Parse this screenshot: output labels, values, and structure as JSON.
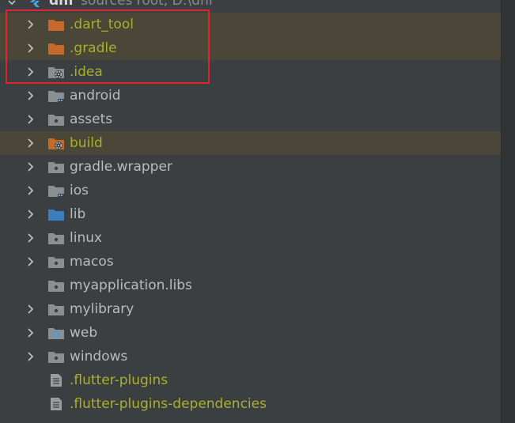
{
  "root": {
    "name": "dnf",
    "suffix": "sources root, D:\\dnf"
  },
  "colors": {
    "bg": "#3c3f41",
    "text": "#bbbbbb",
    "excluded": "#a8b02c",
    "excluded_row": "#4a4638",
    "folder": "#8c8f92",
    "excluded_folder": "#c7692b",
    "source_folder": "#3a7fbf",
    "selection_box": "#e0262b"
  },
  "items": [
    {
      "label": ".dart_tool",
      "icon": "folder-excluded-icon",
      "expandable": true,
      "excluded": true
    },
    {
      "label": ".gradle",
      "icon": "folder-excluded-icon",
      "expandable": true,
      "excluded": true
    },
    {
      "label": ".idea",
      "icon": "folder-idea-icon",
      "expandable": true,
      "excluded": true
    },
    {
      "label": "android",
      "icon": "folder-module-icon",
      "expandable": true,
      "excluded": false
    },
    {
      "label": "assets",
      "icon": "folder-icon",
      "expandable": true,
      "excluded": false
    },
    {
      "label": "build",
      "icon": "folder-excluded-gear-icon",
      "expandable": true,
      "excluded": true
    },
    {
      "label": "gradle.wrapper",
      "icon": "folder-icon",
      "expandable": true,
      "excluded": false
    },
    {
      "label": "ios",
      "icon": "folder-module-icon",
      "expandable": true,
      "excluded": false
    },
    {
      "label": "lib",
      "icon": "folder-source-icon",
      "expandable": true,
      "excluded": false
    },
    {
      "label": "linux",
      "icon": "folder-icon",
      "expandable": true,
      "excluded": false
    },
    {
      "label": "macos",
      "icon": "folder-icon",
      "expandable": true,
      "excluded": false
    },
    {
      "label": "myapplication.libs",
      "icon": "folder-icon",
      "expandable": false,
      "excluded": false
    },
    {
      "label": "mylibrary",
      "icon": "folder-icon",
      "expandable": true,
      "excluded": false
    },
    {
      "label": "web",
      "icon": "folder-web-icon",
      "expandable": true,
      "excluded": false
    },
    {
      "label": "windows",
      "icon": "folder-icon",
      "expandable": true,
      "excluded": false
    },
    {
      "label": ".flutter-plugins",
      "icon": "file-text-icon",
      "expandable": false,
      "excluded": true
    },
    {
      "label": ".flutter-plugins-dependencies",
      "icon": "file-text-icon",
      "expandable": false,
      "excluded": true
    }
  ]
}
